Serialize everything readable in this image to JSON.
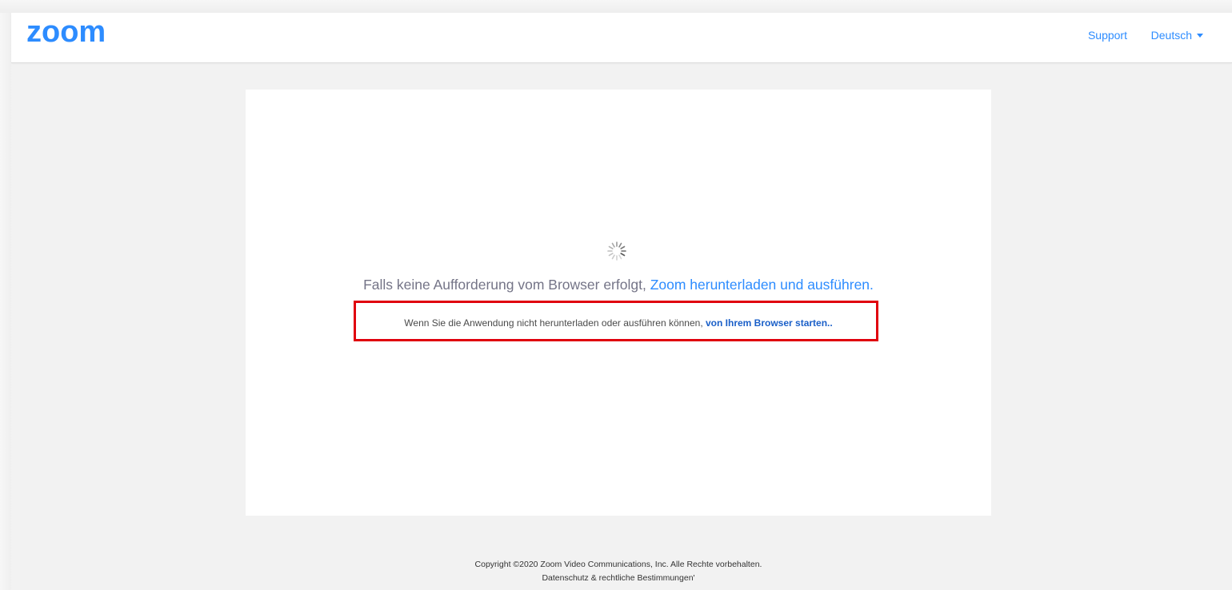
{
  "header": {
    "logo_text": "zoom",
    "support_label": "Support",
    "language_label": "Deutsch"
  },
  "main": {
    "prompt_text": "Falls keine Aufforderung vom Browser erfolgt, ",
    "download_link": "Zoom herunterladen und ausführen",
    "prompt_end": ".",
    "fallback_text": "Wenn Sie die Anwendung nicht herunterladen oder ausführen können, ",
    "browser_link": "von Ihrem Browser starten.."
  },
  "footer": {
    "copyright": "Copyright ©2020 Zoom Video Communications, Inc. Alle Rechte vorbehalten.",
    "privacy_link": "Datenschutz & rechtliche Bestimmungen'"
  },
  "colors": {
    "brand_blue": "#2D8CFF",
    "highlight_red": "#e0000e",
    "page_background": "#f2f2f2"
  },
  "icons": {
    "logo": "zoom-logo",
    "spinner": "loading-spinner-icon",
    "language_caret": "caret-down-icon"
  }
}
